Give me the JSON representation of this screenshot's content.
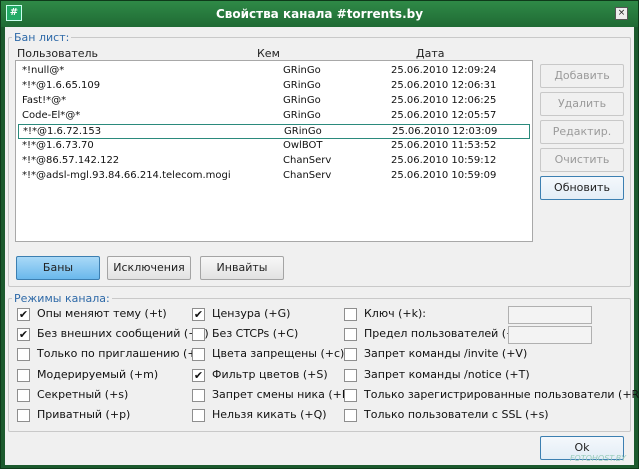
{
  "window": {
    "title": "Свойства канала #torrents.by",
    "close": "×"
  },
  "ban": {
    "legend": "Бан лист:",
    "columns": [
      "Пользователь",
      "Кем",
      "Дата"
    ],
    "rows": [
      {
        "user": "*!null@*",
        "by": "GRinGo",
        "date": "25.06.2010 12:09:24"
      },
      {
        "user": "*!*@1.6.65.109",
        "by": "GRinGo",
        "date": "25.06.2010 12:06:31"
      },
      {
        "user": "Fast!*@*",
        "by": "GRinGo",
        "date": "25.06.2010 12:06:25"
      },
      {
        "user": "Code-El*@*",
        "by": "GRinGo",
        "date": "25.06.2010 12:05:57"
      },
      {
        "user": "*!*@1.6.72.153",
        "by": "GRinGo",
        "date": "25.06.2010 12:03:09"
      },
      {
        "user": "*!*@1.6.73.70",
        "by": "OwlBOT",
        "date": "25.06.2010 11:53:52"
      },
      {
        "user": "*!*@86.57.142.122",
        "by": "ChanServ",
        "date": "25.06.2010 10:59:12"
      },
      {
        "user": "*!*@adsl-mgl.93.84.66.214.telecom.mogi",
        "by": "ChanServ",
        "date": "25.06.2010 10:59:09"
      }
    ],
    "buttons": {
      "add": "Добавить",
      "delete": "Удалить",
      "edit": "Редактир.",
      "clear": "Очистить",
      "refresh": "Обновить"
    },
    "tabs": {
      "bans": "Баны",
      "exceptions": "Исключения",
      "invites": "Инвайты"
    }
  },
  "modes": {
    "legend": "Режимы канала:",
    "col1": [
      {
        "label": "Опы меняют тему (+t)",
        "checked": "✔"
      },
      {
        "label": "Без внешних сообщений (+n)",
        "checked": "✔"
      },
      {
        "label": "Только по приглашению (+i)",
        "checked": ""
      },
      {
        "label": "Модерируемый (+m)",
        "checked": ""
      },
      {
        "label": "Секретный (+s)",
        "checked": ""
      },
      {
        "label": "Приватный (+p)",
        "checked": ""
      }
    ],
    "col2": [
      {
        "label": "Цензура (+G)",
        "checked": "✔"
      },
      {
        "label": "Без CTCPs (+C)",
        "checked": ""
      },
      {
        "label": "Цвета запрещены (+c)",
        "checked": ""
      },
      {
        "label": "Фильтр цветов (+S)",
        "checked": "✔"
      },
      {
        "label": "Запрет смены ника (+N)",
        "checked": ""
      },
      {
        "label": "Нельзя кикать (+Q)",
        "checked": ""
      }
    ],
    "col3": [
      {
        "label": "Ключ (+k):",
        "checked": ""
      },
      {
        "label": "Предел пользователей (+l):",
        "checked": ""
      },
      {
        "label": "Запрет команды /invite (+V)",
        "checked": ""
      },
      {
        "label": "Запрет команды /notice (+T)",
        "checked": ""
      },
      {
        "label": "Только зарегистрированные пользователи (+R)",
        "checked": ""
      },
      {
        "label": "Только пользователи с SSL (+s)",
        "checked": ""
      }
    ],
    "key_value": "",
    "limit_value": ""
  },
  "ok": "Ok",
  "watermark": "FOTOHOST.BY"
}
